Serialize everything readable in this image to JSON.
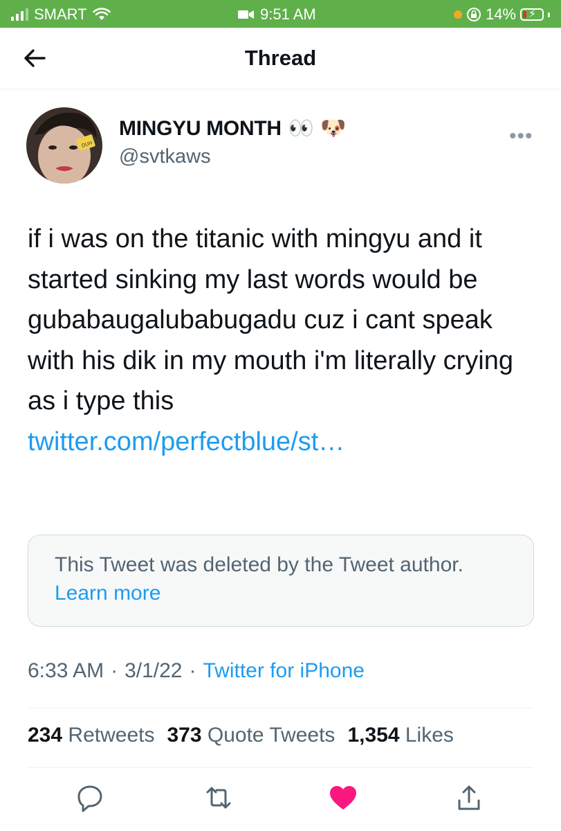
{
  "status_bar": {
    "carrier": "SMART",
    "time": "9:51 AM",
    "battery": "14%"
  },
  "header": {
    "title": "Thread",
    "back_icon": "back-arrow-icon"
  },
  "author": {
    "name": "MINGYU MONTH",
    "emoji": "👀 🐶",
    "handle": "@svtkaws",
    "avatar_sticker": "DUH"
  },
  "tweet": {
    "text": "if i was on the titanic with mingyu and it started sinking my last words would be gubabaugalubabugadu cuz i cant speak with his dik in my mouth i'm literally crying as i type this",
    "link": "twitter.com/perfectblue/st…"
  },
  "deleted_notice": {
    "text": "This Tweet was deleted by the Tweet author.",
    "link": "Learn more"
  },
  "meta": {
    "time": "6:33 AM",
    "date": "3/1/22",
    "source": "Twitter for iPhone"
  },
  "stats": {
    "retweets": "234",
    "retweets_label": "Retweets",
    "quotes": "373",
    "quotes_label": "Quote Tweets",
    "likes": "1,354",
    "likes_label": "Likes"
  },
  "colors": {
    "status_bar": "#5fb04a",
    "link": "#1d9bf0",
    "like": "#f91880",
    "muted": "#536471"
  },
  "icons": [
    "reply-icon",
    "retweet-icon",
    "like-icon",
    "share-icon",
    "more-icon"
  ]
}
